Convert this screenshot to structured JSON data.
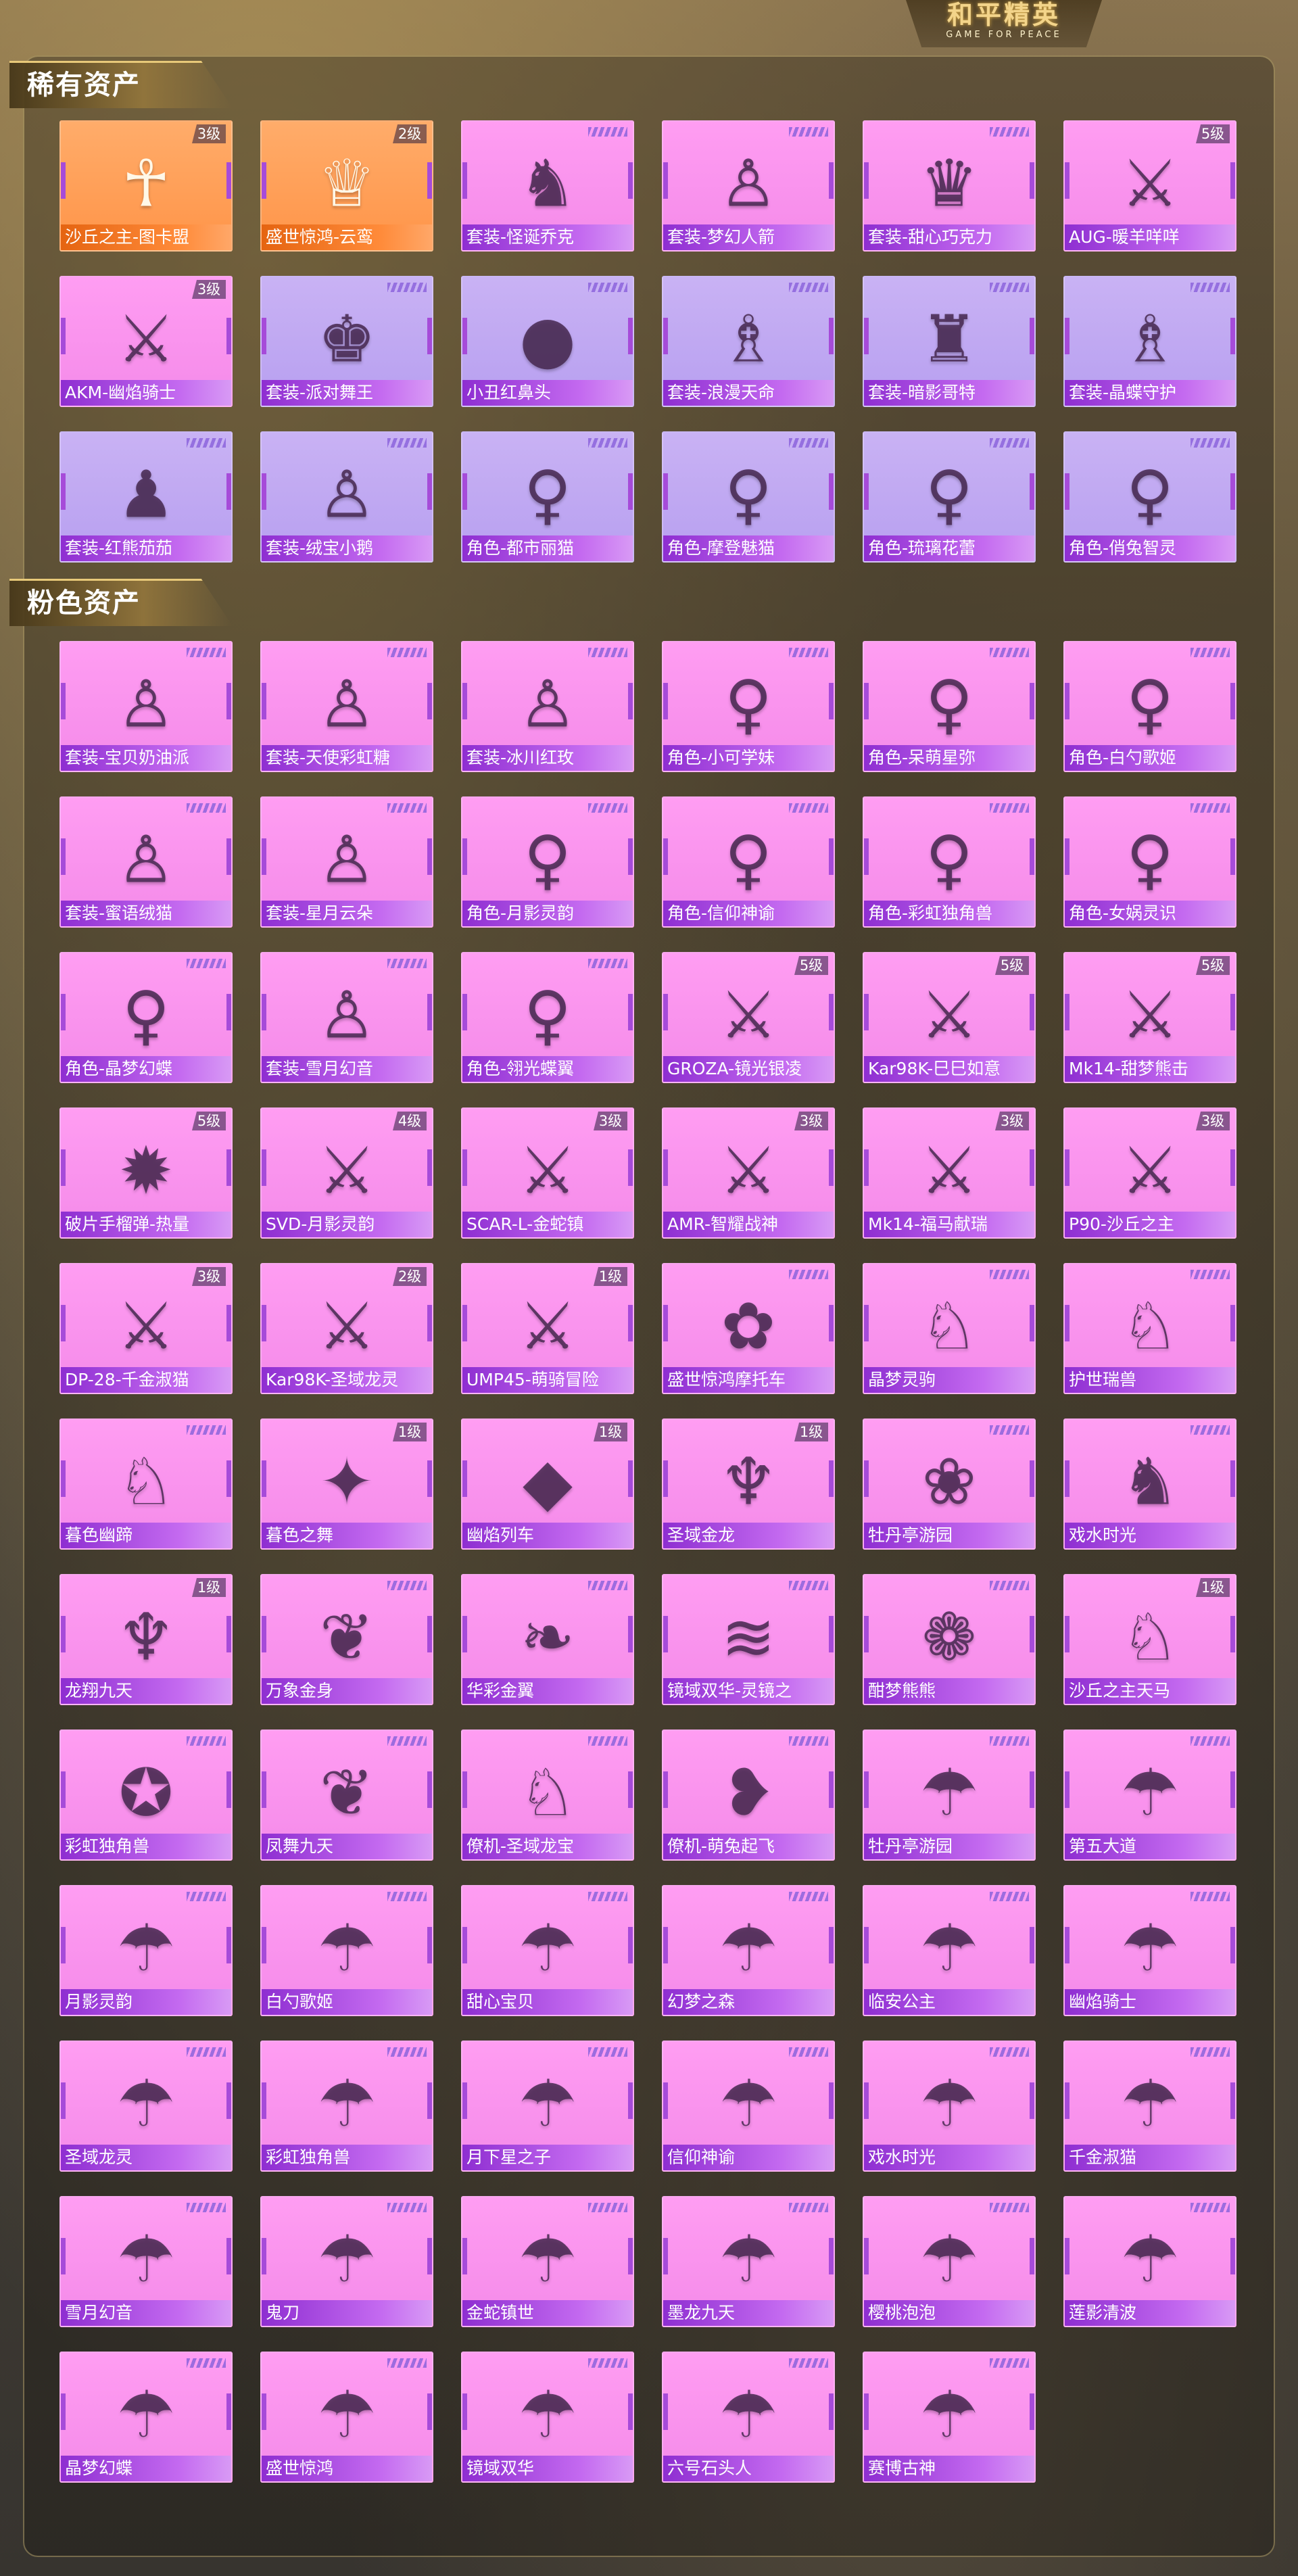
{
  "header": {
    "logo_main": "和平精英",
    "logo_sub": "GAME FOR PEACE"
  },
  "sections": {
    "rare_title": "稀有资产",
    "pink_title": "粉色资产"
  },
  "rare_items": [
    {
      "name": "沙丘之主-图卡盟",
      "level": "3级",
      "bg": "orange",
      "icon": "figure-icon",
      "glyph": "☥"
    },
    {
      "name": "盛世惊鸿-云鸾",
      "level": "2级",
      "bg": "orange",
      "icon": "figure-icon",
      "glyph": "♕"
    },
    {
      "name": "套装-怪诞乔克",
      "level": "",
      "bg": "pink",
      "icon": "outfit-icon",
      "glyph": "♞"
    },
    {
      "name": "套装-梦幻人箭",
      "level": "",
      "bg": "pink",
      "icon": "outfit-icon",
      "glyph": "♙"
    },
    {
      "name": "套装-甜心巧克力",
      "level": "",
      "bg": "pink",
      "icon": "outfit-icon",
      "glyph": "♛"
    },
    {
      "name": "AUG-暖羊咩咩",
      "level": "5级",
      "bg": "pink",
      "icon": "rifle-icon",
      "glyph": "⚔"
    },
    {
      "name": "AKM-幽焰骑士",
      "level": "3级",
      "bg": "pink",
      "icon": "rifle-icon",
      "glyph": "⚔"
    },
    {
      "name": "套装-派对舞王",
      "level": "",
      "bg": "violet",
      "icon": "outfit-icon",
      "glyph": "♚"
    },
    {
      "name": "小丑红鼻头",
      "level": "",
      "bg": "violet",
      "icon": "red-nose-icon",
      "glyph": "●"
    },
    {
      "name": "套装-浪漫天命",
      "level": "",
      "bg": "violet",
      "icon": "outfit-icon",
      "glyph": "♗"
    },
    {
      "name": "套装-暗影哥特",
      "level": "",
      "bg": "violet",
      "icon": "outfit-icon",
      "glyph": "♜"
    },
    {
      "name": "套装-晶蝶守护",
      "level": "",
      "bg": "violet",
      "icon": "outfit-icon",
      "glyph": "♗"
    },
    {
      "name": "套装-红熊茄茄",
      "level": "",
      "bg": "violet",
      "icon": "outfit-icon",
      "glyph": "♟"
    },
    {
      "name": "套装-绒宝小鹅",
      "level": "",
      "bg": "violet",
      "icon": "outfit-icon",
      "glyph": "♙"
    },
    {
      "name": "角色-都市丽猫",
      "level": "",
      "bg": "violet",
      "icon": "character-icon",
      "glyph": "♀"
    },
    {
      "name": "角色-摩登魅猫",
      "level": "",
      "bg": "violet",
      "icon": "character-icon",
      "glyph": "♀"
    },
    {
      "name": "角色-琉璃花蕾",
      "level": "",
      "bg": "violet",
      "icon": "character-icon",
      "glyph": "♀"
    },
    {
      "name": "角色-俏兔智灵",
      "level": "",
      "bg": "violet",
      "icon": "character-icon",
      "glyph": "♀"
    }
  ],
  "pink_items": [
    {
      "name": "套装-宝贝奶油派",
      "level": "",
      "icon": "outfit-icon",
      "glyph": "♙"
    },
    {
      "name": "套装-天使彩虹糖",
      "level": "",
      "icon": "outfit-icon",
      "glyph": "♙"
    },
    {
      "name": "套装-冰川红玫",
      "level": "",
      "icon": "outfit-icon",
      "glyph": "♙"
    },
    {
      "name": "角色-小可学妹",
      "level": "",
      "icon": "character-icon",
      "glyph": "♀"
    },
    {
      "name": "角色-呆萌星弥",
      "level": "",
      "icon": "character-icon",
      "glyph": "♀"
    },
    {
      "name": "角色-白勺歌姬",
      "level": "",
      "icon": "character-icon",
      "glyph": "♀"
    },
    {
      "name": "套装-蜜语绒猫",
      "level": "",
      "icon": "outfit-icon",
      "glyph": "♙"
    },
    {
      "name": "套装-星月云朵",
      "level": "",
      "icon": "outfit-icon",
      "glyph": "♙"
    },
    {
      "name": "角色-月影灵韵",
      "level": "",
      "icon": "character-icon",
      "glyph": "♀"
    },
    {
      "name": "角色-信仰神谕",
      "level": "",
      "icon": "character-icon",
      "glyph": "♀"
    },
    {
      "name": "角色-彩虹独角兽",
      "level": "",
      "icon": "character-icon",
      "glyph": "♀"
    },
    {
      "name": "角色-女娲灵识",
      "level": "",
      "icon": "character-icon",
      "glyph": "♀"
    },
    {
      "name": "角色-晶梦幻蝶",
      "level": "",
      "icon": "character-icon",
      "glyph": "♀"
    },
    {
      "name": "套装-雪月幻音",
      "level": "",
      "icon": "outfit-icon",
      "glyph": "♙"
    },
    {
      "name": "角色-翎光蝶翼",
      "level": "",
      "icon": "character-icon",
      "glyph": "♀"
    },
    {
      "name": "GROZA-镜光银凌",
      "level": "5级",
      "icon": "rifle-icon",
      "glyph": "⚔"
    },
    {
      "name": "Kar98K-巳巳如意",
      "level": "5级",
      "icon": "rifle-icon",
      "glyph": "⚔"
    },
    {
      "name": "Mk14-甜梦熊击",
      "level": "5级",
      "icon": "rifle-icon",
      "glyph": "⚔"
    },
    {
      "name": "破片手榴弹-热量",
      "level": "5级",
      "icon": "grenade-icon",
      "glyph": "✹"
    },
    {
      "name": "SVD-月影灵韵",
      "level": "4级",
      "icon": "rifle-icon",
      "glyph": "⚔"
    },
    {
      "name": "SCAR-L-金蛇镇",
      "level": "3级",
      "icon": "rifle-icon",
      "glyph": "⚔"
    },
    {
      "name": "AMR-智耀战神",
      "level": "3级",
      "icon": "rifle-icon",
      "glyph": "⚔"
    },
    {
      "name": "Mk14-福马献瑞",
      "level": "3级",
      "icon": "rifle-icon",
      "glyph": "⚔"
    },
    {
      "name": "P90-沙丘之主",
      "level": "3级",
      "icon": "rifle-icon",
      "glyph": "⚔"
    },
    {
      "name": "DP-28-千金淑猫",
      "level": "3级",
      "icon": "rifle-icon",
      "glyph": "⚔"
    },
    {
      "name": "Kar98K-圣域龙灵",
      "level": "2级",
      "icon": "rifle-icon",
      "glyph": "⚔"
    },
    {
      "name": "UMP45-萌骑冒险",
      "level": "1级",
      "icon": "smg-icon",
      "glyph": "⚔"
    },
    {
      "name": "盛世惊鸿摩托车",
      "level": "",
      "icon": "motorcycle-icon",
      "glyph": "✿"
    },
    {
      "name": "晶梦灵驹",
      "level": "",
      "icon": "horse-icon",
      "glyph": "♘"
    },
    {
      "name": "护世瑞兽",
      "level": "",
      "icon": "horse-icon",
      "glyph": "♘"
    },
    {
      "name": "暮色幽蹄",
      "level": "",
      "icon": "horse-icon",
      "glyph": "♘"
    },
    {
      "name": "暮色之舞",
      "level": "1级",
      "icon": "wand-icon",
      "glyph": "✦"
    },
    {
      "name": "幽焰列车",
      "level": "1级",
      "icon": "glider-icon",
      "glyph": "◆"
    },
    {
      "name": "圣域金龙",
      "level": "1级",
      "icon": "dragon-icon",
      "glyph": "♆"
    },
    {
      "name": "牡丹亭游园",
      "level": "",
      "icon": "ornament-icon",
      "glyph": "❀"
    },
    {
      "name": "戏水时光",
      "level": "",
      "icon": "giraffe-icon",
      "glyph": "♞"
    },
    {
      "name": "龙翔九天",
      "level": "1级",
      "icon": "dragon-icon",
      "glyph": "♆"
    },
    {
      "name": "万象金身",
      "level": "",
      "icon": "feather-icon",
      "glyph": "❦"
    },
    {
      "name": "华彩金翼",
      "level": "",
      "icon": "wing-icon",
      "glyph": "❧"
    },
    {
      "name": "镜域双华-灵镜之",
      "level": "",
      "icon": "blades-icon",
      "glyph": "≋"
    },
    {
      "name": "酣梦熊熊",
      "level": "",
      "icon": "bear-icon",
      "glyph": "❁"
    },
    {
      "name": "沙丘之主天马",
      "level": "1级",
      "icon": "pegasus-icon",
      "glyph": "♘"
    },
    {
      "name": "彩虹独角兽",
      "level": "",
      "icon": "unicorn-icon",
      "glyph": "✪"
    },
    {
      "name": "凤舞九天",
      "level": "",
      "icon": "phoenix-icon",
      "glyph": "❦"
    },
    {
      "name": "僚机-圣域龙宝",
      "level": "",
      "icon": "pet-icon",
      "glyph": "♘"
    },
    {
      "name": "僚机-萌兔起飞",
      "level": "",
      "icon": "balloon-icon",
      "glyph": "❥"
    },
    {
      "name": "牡丹亭游园",
      "level": "",
      "icon": "parachute-icon",
      "glyph": "☂"
    },
    {
      "name": "第五大道",
      "level": "",
      "icon": "parachute-icon",
      "glyph": "☂"
    },
    {
      "name": "月影灵韵",
      "level": "",
      "icon": "parachute-icon",
      "glyph": "☂"
    },
    {
      "name": "白勺歌姬",
      "level": "",
      "icon": "parachute-icon",
      "glyph": "☂"
    },
    {
      "name": "甜心宝贝",
      "level": "",
      "icon": "parachute-icon",
      "glyph": "☂"
    },
    {
      "name": "幻梦之森",
      "level": "",
      "icon": "parachute-icon",
      "glyph": "☂"
    },
    {
      "name": "临安公主",
      "level": "",
      "icon": "parachute-icon",
      "glyph": "☂"
    },
    {
      "name": "幽焰骑士",
      "level": "",
      "icon": "parachute-icon",
      "glyph": "☂"
    },
    {
      "name": "圣域龙灵",
      "level": "",
      "icon": "parachute-icon",
      "glyph": "☂"
    },
    {
      "name": "彩虹独角兽",
      "level": "",
      "icon": "parachute-icon",
      "glyph": "☂"
    },
    {
      "name": "月下星之子",
      "level": "",
      "icon": "parachute-icon",
      "glyph": "☂"
    },
    {
      "name": "信仰神谕",
      "level": "",
      "icon": "parachute-icon",
      "glyph": "☂"
    },
    {
      "name": "戏水时光",
      "level": "",
      "icon": "parachute-icon",
      "glyph": "☂"
    },
    {
      "name": "千金淑猫",
      "level": "",
      "icon": "parachute-icon",
      "glyph": "☂"
    },
    {
      "name": "雪月幻音",
      "level": "",
      "icon": "parachute-icon",
      "glyph": "☂"
    },
    {
      "name": "鬼刀",
      "level": "",
      "icon": "parachute-icon",
      "glyph": "☂"
    },
    {
      "name": "金蛇镇世",
      "level": "",
      "icon": "parachute-icon",
      "glyph": "☂"
    },
    {
      "name": "墨龙九天",
      "level": "",
      "icon": "parachute-icon",
      "glyph": "☂"
    },
    {
      "name": "樱桃泡泡",
      "level": "",
      "icon": "parachute-icon",
      "glyph": "☂"
    },
    {
      "name": "莲影清波",
      "level": "",
      "icon": "parachute-icon",
      "glyph": "☂"
    },
    {
      "name": "晶梦幻蝶",
      "level": "",
      "icon": "parachute-icon",
      "glyph": "☂"
    },
    {
      "name": "盛世惊鸿",
      "level": "",
      "icon": "parachute-icon",
      "glyph": "☂"
    },
    {
      "name": "镜域双华",
      "level": "",
      "icon": "parachute-icon",
      "glyph": "☂"
    },
    {
      "name": "六号石头人",
      "level": "",
      "icon": "parachute-icon",
      "glyph": "☂"
    },
    {
      "name": "赛博古神",
      "level": "",
      "icon": "parachute-icon",
      "glyph": "☂"
    }
  ]
}
